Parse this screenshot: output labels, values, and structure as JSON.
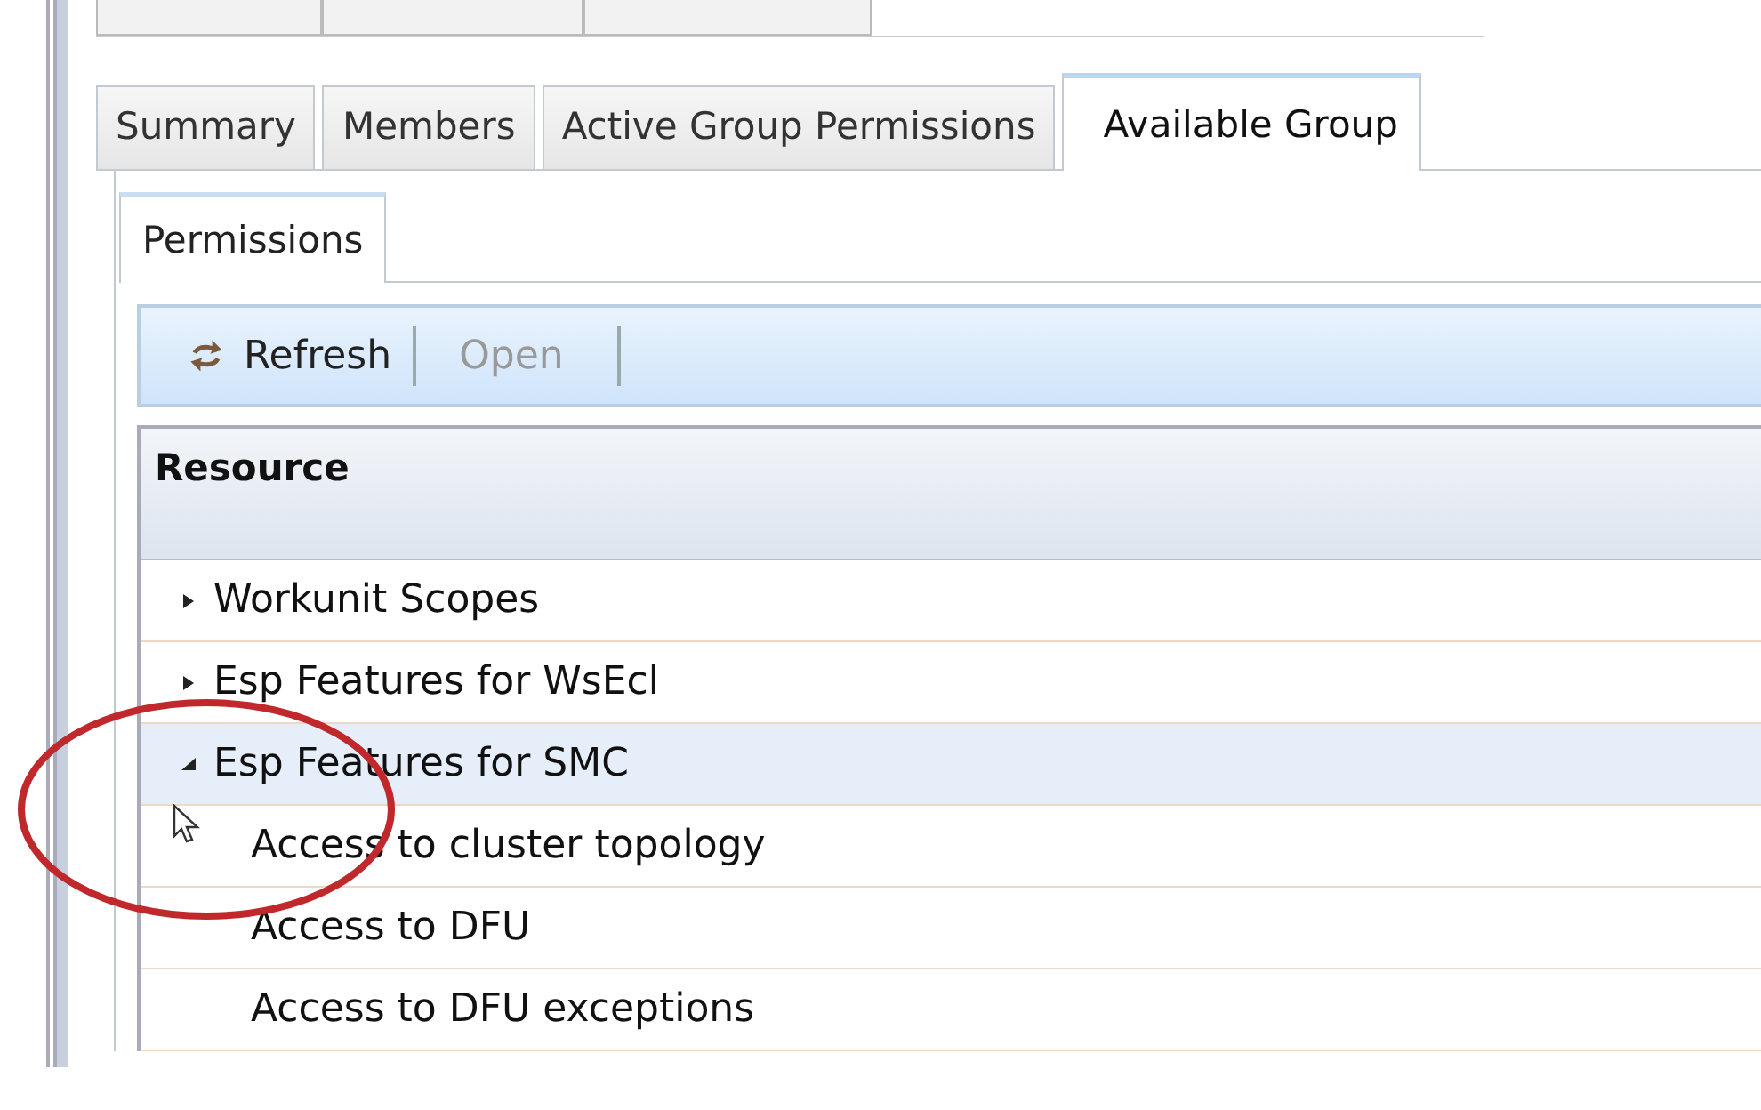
{
  "tabs": [
    {
      "label": "Summary",
      "selected": false
    },
    {
      "label": "Members",
      "selected": false
    },
    {
      "label": "Active Group Permissions",
      "selected": false
    },
    {
      "label": "Available Group",
      "selected": true
    }
  ],
  "subtabs": [
    {
      "label": "Permissions",
      "selected": true
    }
  ],
  "toolbar": [
    {
      "label": "Refresh",
      "disabled": false,
      "kind": "refresh"
    },
    {
      "label": "Open",
      "disabled": true,
      "kind": "plain"
    }
  ],
  "grid": {
    "columns": [
      "Resource"
    ],
    "rows": [
      {
        "label": "Workunit Scopes",
        "expanded": false,
        "selected": false,
        "children": []
      },
      {
        "label": "Esp Features for WsEcl",
        "expanded": false,
        "selected": false,
        "children": []
      },
      {
        "label": "Esp Features for SMC",
        "expanded": true,
        "selected": true,
        "children": [
          {
            "label": "Access to cluster topology",
            "selected": false
          },
          {
            "label": "Access to DFU",
            "selected": false
          },
          {
            "label": "Access to DFU exceptions",
            "selected": false
          }
        ]
      }
    ]
  }
}
